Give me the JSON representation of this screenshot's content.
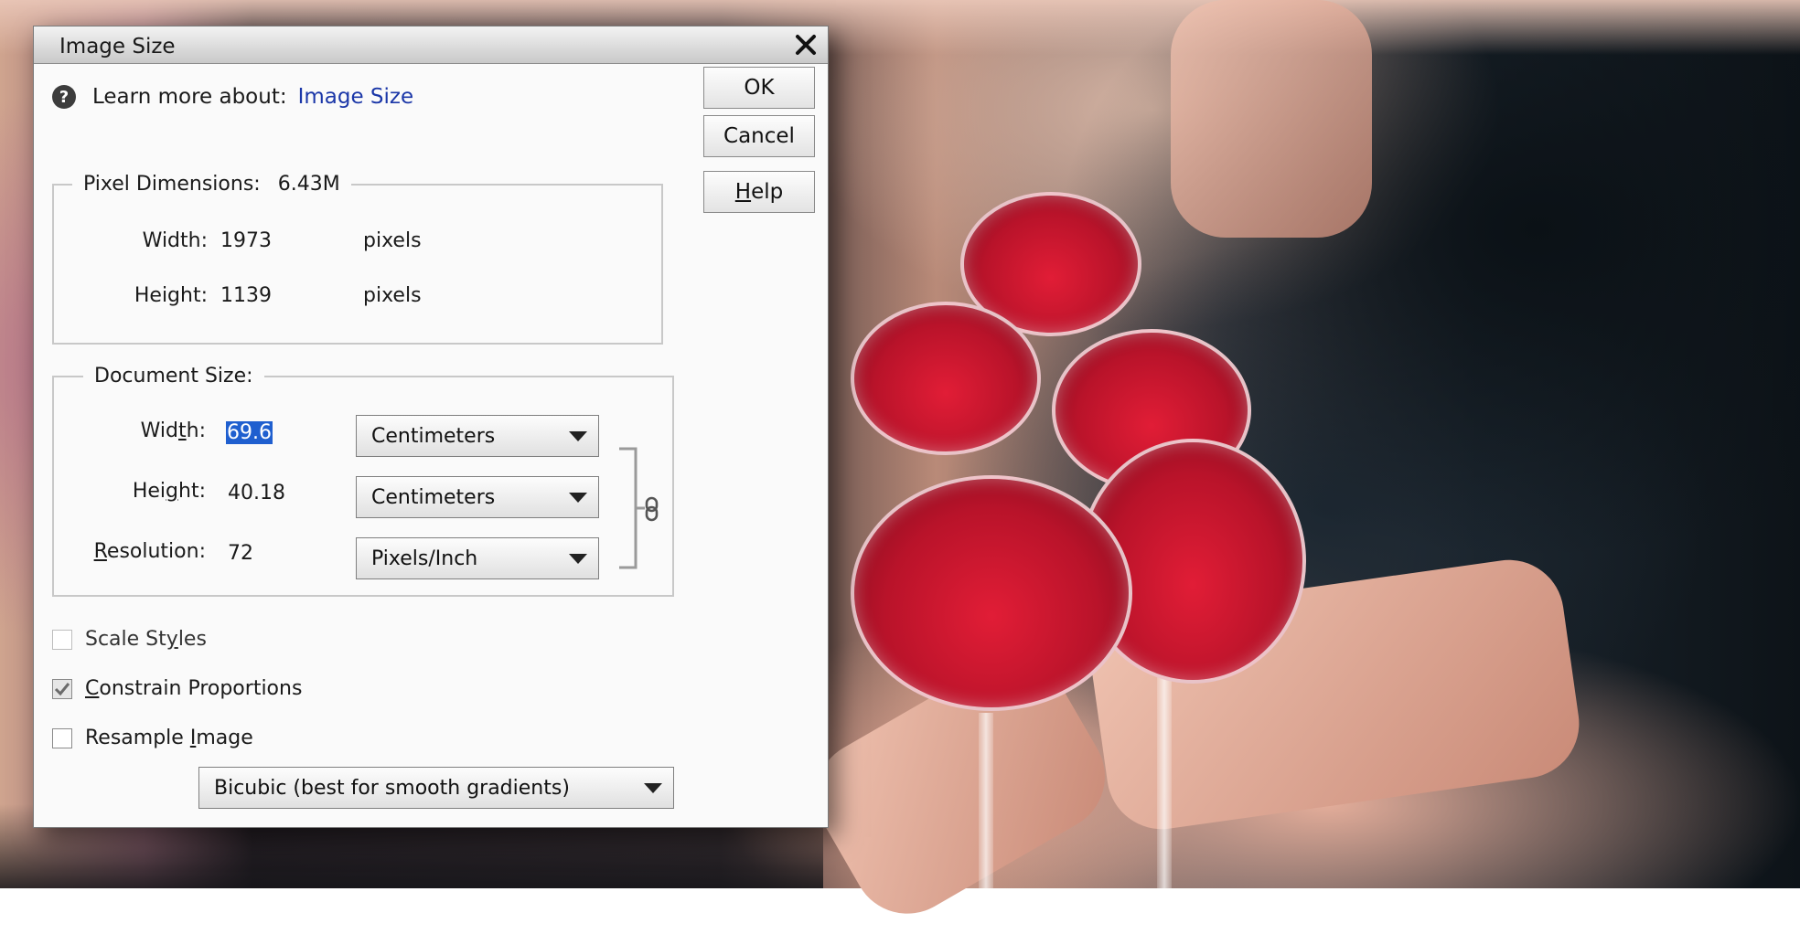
{
  "dialog": {
    "title": "Image Size",
    "learn_prefix": "Learn more about:",
    "learn_link": "Image Size"
  },
  "buttons": {
    "ok": "OK",
    "cancel": "Cancel",
    "help_first": "H",
    "help_rest": "elp"
  },
  "pixel_dimensions": {
    "label": "Pixel Dimensions:",
    "size": "6.43M",
    "width_label": "Width:",
    "width_value": "1973",
    "width_unit": "pixels",
    "height_label": "Height:",
    "height_value": "1139",
    "height_unit": "pixels"
  },
  "document_size": {
    "label": "Document Size:",
    "width_label_pre": "Wid",
    "width_label_u": "t",
    "width_label_post": "h:",
    "width_value": "69.6",
    "width_unit": "Centimeters",
    "height_label_pre": "Hei",
    "height_label_u": "g",
    "height_label_post": "ht:",
    "height_value": "40.18",
    "height_unit": "Centimeters",
    "resolution_label_u": "R",
    "resolution_label_post": "esolution:",
    "resolution_value": "72",
    "resolution_unit": "Pixels/Inch"
  },
  "options": {
    "scale_styles_pre": "Scale St",
    "scale_styles_u": "y",
    "scale_styles_post": "les",
    "scale_styles_checked": false,
    "constrain_u": "C",
    "constrain_post": "onstrain Proportions",
    "constrain_checked": true,
    "resample_pre": "Resample ",
    "resample_u": "I",
    "resample_post": "mage",
    "resample_checked": false,
    "resample_method": "Bicubic (best for smooth gradients)"
  },
  "colors": {
    "link": "#1b37a8",
    "selection": "#1f5fcf",
    "wine": "#d3182f"
  }
}
